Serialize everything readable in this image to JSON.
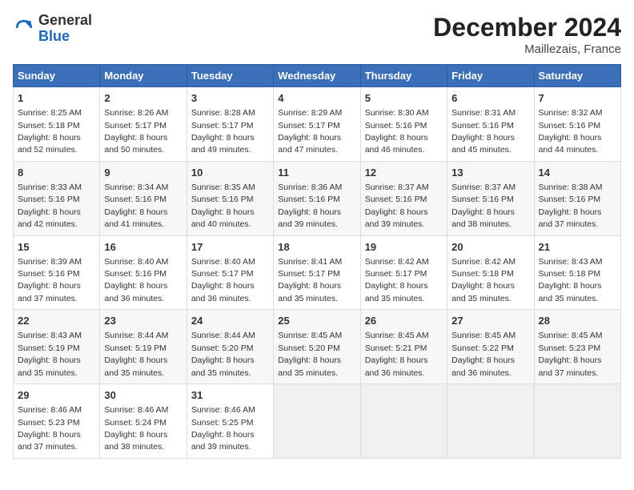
{
  "header": {
    "logo_general": "General",
    "logo_blue": "Blue",
    "month_title": "December 2024",
    "location": "Maillezais, France"
  },
  "days_of_week": [
    "Sunday",
    "Monday",
    "Tuesday",
    "Wednesday",
    "Thursday",
    "Friday",
    "Saturday"
  ],
  "weeks": [
    [
      {
        "day": "1",
        "sunrise": "8:25 AM",
        "sunset": "5:18 PM",
        "daylight": "8 hours and 52 minutes."
      },
      {
        "day": "2",
        "sunrise": "8:26 AM",
        "sunset": "5:17 PM",
        "daylight": "8 hours and 50 minutes."
      },
      {
        "day": "3",
        "sunrise": "8:28 AM",
        "sunset": "5:17 PM",
        "daylight": "8 hours and 49 minutes."
      },
      {
        "day": "4",
        "sunrise": "8:29 AM",
        "sunset": "5:17 PM",
        "daylight": "8 hours and 47 minutes."
      },
      {
        "day": "5",
        "sunrise": "8:30 AM",
        "sunset": "5:16 PM",
        "daylight": "8 hours and 46 minutes."
      },
      {
        "day": "6",
        "sunrise": "8:31 AM",
        "sunset": "5:16 PM",
        "daylight": "8 hours and 45 minutes."
      },
      {
        "day": "7",
        "sunrise": "8:32 AM",
        "sunset": "5:16 PM",
        "daylight": "8 hours and 44 minutes."
      }
    ],
    [
      {
        "day": "8",
        "sunrise": "8:33 AM",
        "sunset": "5:16 PM",
        "daylight": "8 hours and 42 minutes."
      },
      {
        "day": "9",
        "sunrise": "8:34 AM",
        "sunset": "5:16 PM",
        "daylight": "8 hours and 41 minutes."
      },
      {
        "day": "10",
        "sunrise": "8:35 AM",
        "sunset": "5:16 PM",
        "daylight": "8 hours and 40 minutes."
      },
      {
        "day": "11",
        "sunrise": "8:36 AM",
        "sunset": "5:16 PM",
        "daylight": "8 hours and 39 minutes."
      },
      {
        "day": "12",
        "sunrise": "8:37 AM",
        "sunset": "5:16 PM",
        "daylight": "8 hours and 39 minutes."
      },
      {
        "day": "13",
        "sunrise": "8:37 AM",
        "sunset": "5:16 PM",
        "daylight": "8 hours and 38 minutes."
      },
      {
        "day": "14",
        "sunrise": "8:38 AM",
        "sunset": "5:16 PM",
        "daylight": "8 hours and 37 minutes."
      }
    ],
    [
      {
        "day": "15",
        "sunrise": "8:39 AM",
        "sunset": "5:16 PM",
        "daylight": "8 hours and 37 minutes."
      },
      {
        "day": "16",
        "sunrise": "8:40 AM",
        "sunset": "5:16 PM",
        "daylight": "8 hours and 36 minutes."
      },
      {
        "day": "17",
        "sunrise": "8:40 AM",
        "sunset": "5:17 PM",
        "daylight": "8 hours and 36 minutes."
      },
      {
        "day": "18",
        "sunrise": "8:41 AM",
        "sunset": "5:17 PM",
        "daylight": "8 hours and 35 minutes."
      },
      {
        "day": "19",
        "sunrise": "8:42 AM",
        "sunset": "5:17 PM",
        "daylight": "8 hours and 35 minutes."
      },
      {
        "day": "20",
        "sunrise": "8:42 AM",
        "sunset": "5:18 PM",
        "daylight": "8 hours and 35 minutes."
      },
      {
        "day": "21",
        "sunrise": "8:43 AM",
        "sunset": "5:18 PM",
        "daylight": "8 hours and 35 minutes."
      }
    ],
    [
      {
        "day": "22",
        "sunrise": "8:43 AM",
        "sunset": "5:19 PM",
        "daylight": "8 hours and 35 minutes."
      },
      {
        "day": "23",
        "sunrise": "8:44 AM",
        "sunset": "5:19 PM",
        "daylight": "8 hours and 35 minutes."
      },
      {
        "day": "24",
        "sunrise": "8:44 AM",
        "sunset": "5:20 PM",
        "daylight": "8 hours and 35 minutes."
      },
      {
        "day": "25",
        "sunrise": "8:45 AM",
        "sunset": "5:20 PM",
        "daylight": "8 hours and 35 minutes."
      },
      {
        "day": "26",
        "sunrise": "8:45 AM",
        "sunset": "5:21 PM",
        "daylight": "8 hours and 36 minutes."
      },
      {
        "day": "27",
        "sunrise": "8:45 AM",
        "sunset": "5:22 PM",
        "daylight": "8 hours and 36 minutes."
      },
      {
        "day": "28",
        "sunrise": "8:45 AM",
        "sunset": "5:23 PM",
        "daylight": "8 hours and 37 minutes."
      }
    ],
    [
      {
        "day": "29",
        "sunrise": "8:46 AM",
        "sunset": "5:23 PM",
        "daylight": "8 hours and 37 minutes."
      },
      {
        "day": "30",
        "sunrise": "8:46 AM",
        "sunset": "5:24 PM",
        "daylight": "8 hours and 38 minutes."
      },
      {
        "day": "31",
        "sunrise": "8:46 AM",
        "sunset": "5:25 PM",
        "daylight": "8 hours and 39 minutes."
      },
      null,
      null,
      null,
      null
    ]
  ]
}
